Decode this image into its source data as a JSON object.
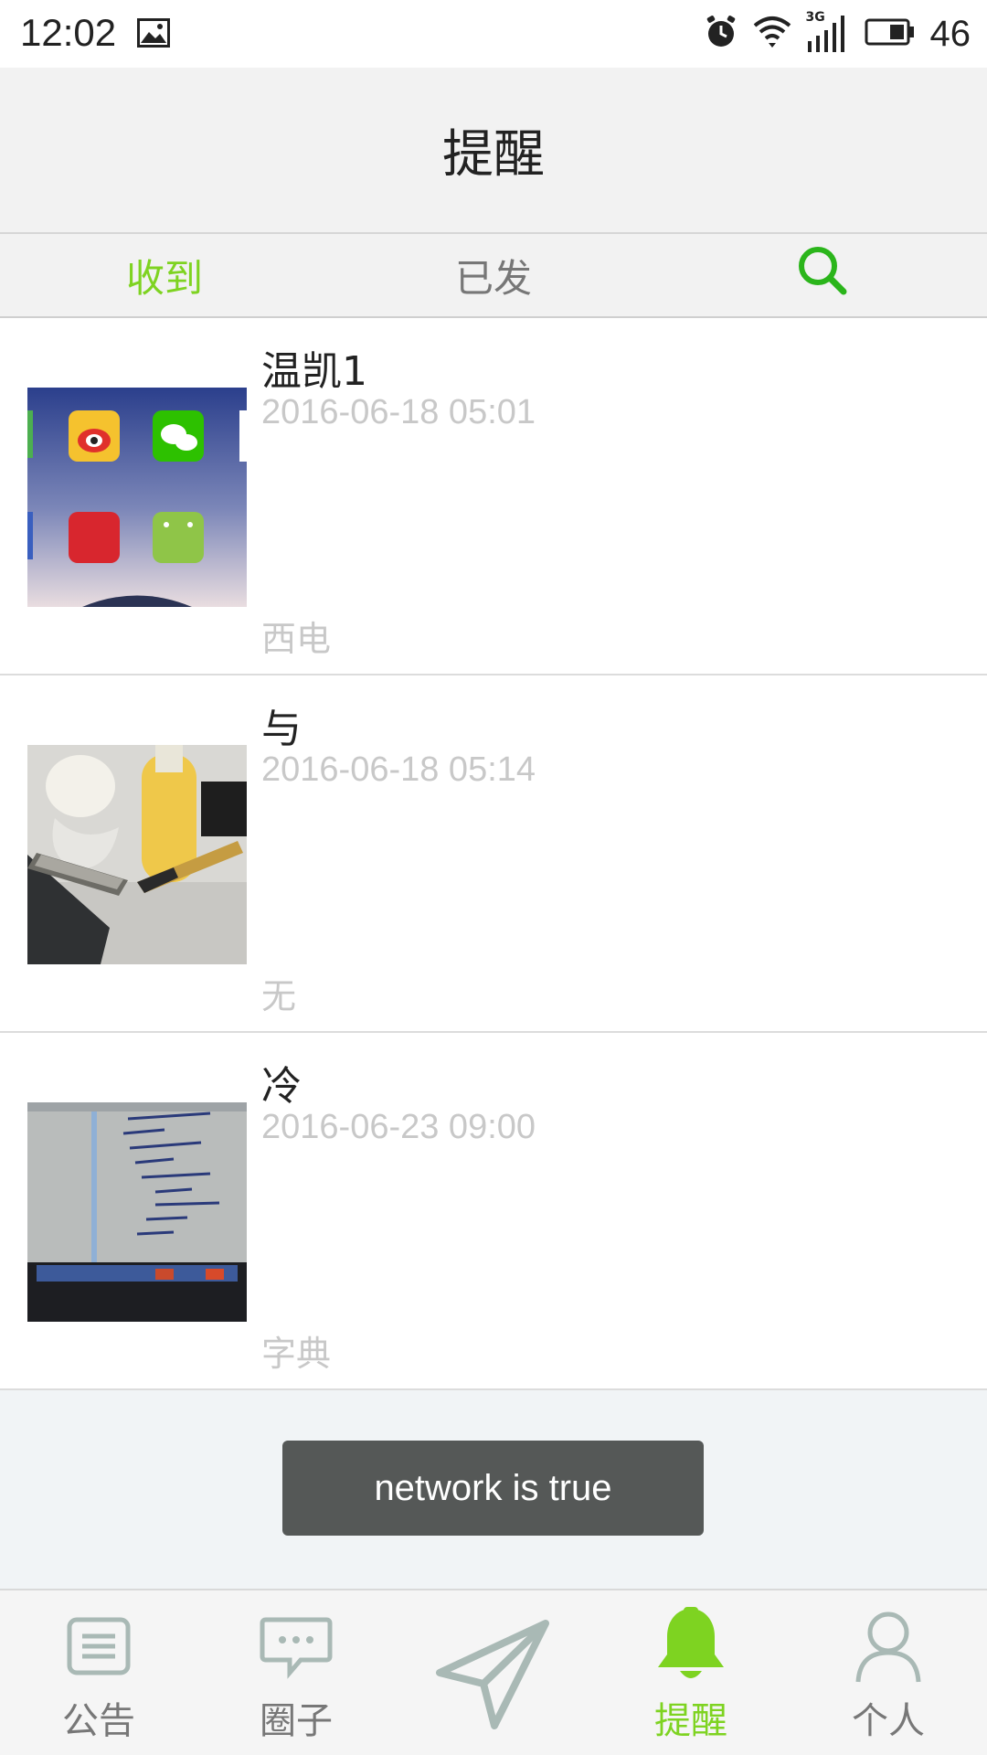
{
  "status_bar": {
    "time": "12:02",
    "battery_level": "46",
    "network": "3G",
    "icons": [
      "image-icon",
      "alarm-icon",
      "wifi-icon",
      "signal-icon",
      "battery-icon"
    ]
  },
  "header": {
    "title": "提醒"
  },
  "tabs": {
    "received": "收到",
    "sent": "已发",
    "search_icon": "search-icon"
  },
  "reminders": [
    {
      "name": "温凯1",
      "time": "2016-06-18 05:01",
      "place": "西电"
    },
    {
      "name": "与",
      "time": "2016-06-18 05:14",
      "place": "无"
    },
    {
      "name": "冷",
      "time": "2016-06-23 09:00",
      "place": "字典"
    }
  ],
  "toast": {
    "text": "network is true"
  },
  "bottom_nav": {
    "items": [
      {
        "label": "公告",
        "icon": "notice-icon"
      },
      {
        "label": "圈子",
        "icon": "chat-bubble-icon"
      },
      {
        "label": "",
        "icon": "send-icon"
      },
      {
        "label": "提醒",
        "icon": "bell-icon"
      },
      {
        "label": "个人",
        "icon": "person-icon"
      }
    ],
    "active": "提醒"
  },
  "colors": {
    "accent": "#7ed321",
    "search": "#2bb51b",
    "muted": "#c8c8c8",
    "toast_bg": "#555857"
  }
}
